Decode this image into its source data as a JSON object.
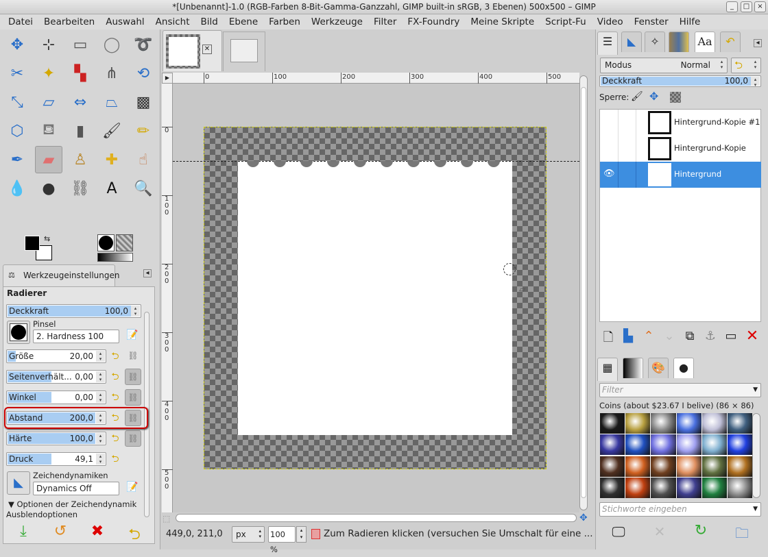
{
  "window": {
    "title": "*[Unbenannt]-1.0 (RGB-Farben 8-Bit-Gamma-Ganzzahl, GIMP built-in sRGB, 3 Ebenen) 500x500 – GIMP",
    "minimize": "_",
    "maximize": "□",
    "close": "×"
  },
  "menu": [
    "Datei",
    "Bearbeiten",
    "Auswahl",
    "Ansicht",
    "Bild",
    "Ebene",
    "Farben",
    "Werkzeuge",
    "Filter",
    "FX-Foundry",
    "Meine Skripte",
    "Script-Fu",
    "Video",
    "Fenster",
    "Hilfe"
  ],
  "tools": [
    {
      "name": "move-tool",
      "glyph": "✥",
      "color": "#2a6fc9"
    },
    {
      "name": "align-tool",
      "glyph": "⊹",
      "color": "#333"
    },
    {
      "name": "rect-select-tool",
      "glyph": "▭",
      "color": "#555"
    },
    {
      "name": "ellipse-select-tool",
      "glyph": "◯",
      "color": "#777"
    },
    {
      "name": "free-select-tool",
      "glyph": "➰",
      "color": "#777"
    },
    {
      "name": "scissors-tool",
      "glyph": "✂",
      "color": "#2a6fc9"
    },
    {
      "name": "fuzzy-select-tool",
      "glyph": "✦",
      "color": "#d4a800"
    },
    {
      "name": "color-select-tool",
      "glyph": "▚",
      "color": "#c22"
    },
    {
      "name": "paths-tool",
      "glyph": "⋔",
      "color": "#555"
    },
    {
      "name": "rotate-tool",
      "glyph": "⟲",
      "color": "#2a6fc9"
    },
    {
      "name": "scale-tool",
      "glyph": "⤡",
      "color": "#2a6fc9"
    },
    {
      "name": "shear-tool",
      "glyph": "▱",
      "color": "#2a6fc9"
    },
    {
      "name": "flip-tool",
      "glyph": "⇔",
      "color": "#2a6fc9"
    },
    {
      "name": "perspective-tool",
      "glyph": "⏢",
      "color": "#2a6fc9"
    },
    {
      "name": "warp-tool",
      "glyph": "▩",
      "color": "#333"
    },
    {
      "name": "cage-tool",
      "glyph": "⬡",
      "color": "#2a6fc9"
    },
    {
      "name": "bucket-fill-tool",
      "glyph": "⛾",
      "color": "#777"
    },
    {
      "name": "gradient-tool",
      "glyph": "▮",
      "color": "#555"
    },
    {
      "name": "paintbrush-tool",
      "glyph": "🖌",
      "color": "#333"
    },
    {
      "name": "pencil-tool",
      "glyph": "✏",
      "color": "#d4a800"
    },
    {
      "name": "airbrush-tool",
      "glyph": "✒",
      "color": "#2a6fc9"
    },
    {
      "name": "eraser-tool",
      "glyph": "▰",
      "color": "#e07070"
    },
    {
      "name": "clone-tool",
      "glyph": "♙",
      "color": "#b8862a"
    },
    {
      "name": "heal-tool",
      "glyph": "✚",
      "color": "#e0b020"
    },
    {
      "name": "smudge-tool",
      "glyph": "☝",
      "color": "#c07040"
    },
    {
      "name": "blur-tool",
      "glyph": "💧",
      "color": "#2a6fc9"
    },
    {
      "name": "dodge-burn-tool",
      "glyph": "●",
      "color": "#333"
    },
    {
      "name": "measure-tool",
      "glyph": "⛓",
      "color": "#555"
    },
    {
      "name": "text-tool",
      "glyph": "A",
      "color": "#111"
    },
    {
      "name": "zoom-tool",
      "glyph": "🔍",
      "color": "#2a6fc9"
    }
  ],
  "tool_options": {
    "tab": "Werkzeugeinstellungen",
    "tool_name": "Radierer",
    "opacity": {
      "label": "Deckkraft",
      "value": "100,0",
      "fraction": 1.0
    },
    "brush_label": "Pinsel",
    "brush": "2. Hardness 100",
    "sliders": [
      {
        "label": "Größe",
        "value": "20,00",
        "fraction": 0.05
      },
      {
        "label": "Seitenverhält...",
        "value": "0,00",
        "fraction": 0.5
      },
      {
        "label": "Winkel",
        "value": "0,00",
        "fraction": 0.5
      },
      {
        "label": "Abstand",
        "value": "200,0",
        "fraction": 1.0
      },
      {
        "label": "Härte",
        "value": "100,0",
        "fraction": 1.0
      },
      {
        "label": "Druck",
        "value": "49,1",
        "fraction": 0.5
      }
    ],
    "dynamics_label": "Zeichendynamiken",
    "dynamics": "Dynamics Off",
    "dyn_options": "▼ Optionen der Zeichendynamik",
    "fade_options": "Ausblendoptionen"
  },
  "rulers": {
    "h": [
      "0",
      "100",
      "200",
      "300",
      "400",
      "500"
    ],
    "v": [
      "0",
      "100",
      "200",
      "300",
      "400",
      "500"
    ]
  },
  "status": {
    "coords": "449,0, 211,0",
    "unit": "px",
    "zoom": "100 %",
    "message": "Zum Radieren klicken (versuchen Sie Umschalt für eine ..."
  },
  "layers": {
    "mode_label": "Modus",
    "mode": "Normal",
    "opacity_label": "Deckkraft",
    "opacity": "100,0",
    "lock_label": "Sperre:",
    "items": [
      {
        "name": "Hintergrund-Kopie #1",
        "visible": false,
        "selected": false
      },
      {
        "name": "Hintergrund-Kopie",
        "visible": false,
        "selected": false
      },
      {
        "name": "Hintergrund",
        "visible": true,
        "selected": true
      }
    ]
  },
  "brushes": {
    "filter_placeholder": "Filter",
    "current": "Coins (about $23.67 I belive) (86 × 86)",
    "tags_placeholder": "Stichworte eingeben",
    "swatches": [
      "#1a1a1a",
      "#b8a040",
      "#8a8a8a",
      "#4a70e0",
      "#c0c0d8",
      "#406080",
      "#3838a0",
      "#2050c0",
      "#7070e0",
      "#a0a0f0",
      "#80b0d0",
      "#2040e0",
      "#503020",
      "#d06020",
      "#704020",
      "#e09060",
      "#607040",
      "#b07020",
      "#303030",
      "#c04010",
      "#505050",
      "#404090",
      "#208040",
      "#909090"
    ]
  }
}
